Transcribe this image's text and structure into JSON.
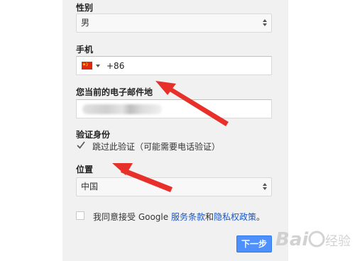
{
  "gender": {
    "label": "性别",
    "value": "男"
  },
  "phone": {
    "label": "手机",
    "country_code": "+86",
    "flag_icon": "china-flag-icon"
  },
  "email": {
    "label": "您当前的电子邮件地"
  },
  "verification": {
    "label": "验证身份",
    "skip_label": "跳过此验证（可能需要电话验证）",
    "checked": true
  },
  "location": {
    "label": "位置",
    "value": "中国"
  },
  "agreement": {
    "prefix": "我同意接受 Google ",
    "terms_link": "服务条款",
    "conjunction": "和",
    "privacy_link": "隐私权政策",
    "suffix": "。",
    "checked": false
  },
  "next_button": {
    "label": "下一步"
  },
  "colors": {
    "panel_bg": "#f1f1f1",
    "button_blue": "#4d90fe",
    "link_blue": "#1a56c4",
    "arrow_red": "#e8302a"
  },
  "watermark": {
    "text": "Bai经验"
  }
}
